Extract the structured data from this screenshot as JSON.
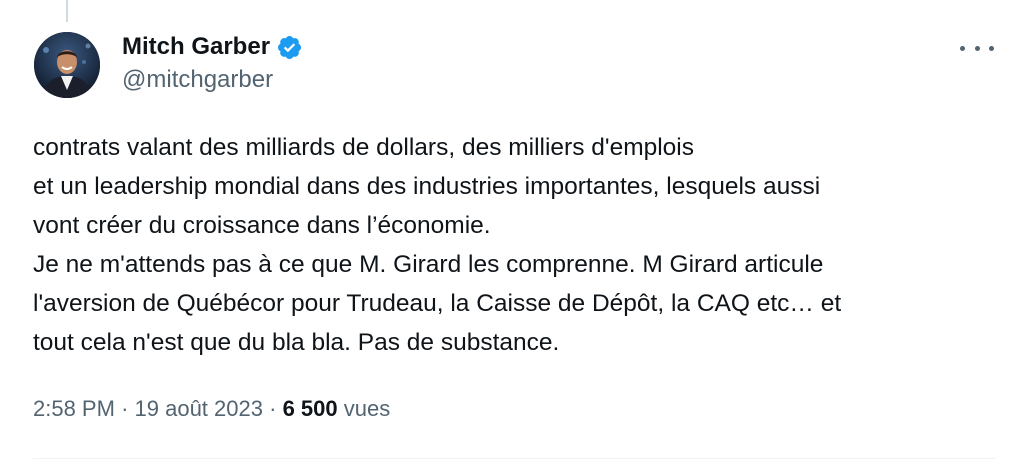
{
  "author": {
    "display_name": "Mitch Garber",
    "handle": "@mitchgarber",
    "verified_icon": "verified-badge-icon",
    "verified_color": "#1d9bf0"
  },
  "tweet": {
    "lines": [
      "contrats valant des milliards de dollars, des milliers d'emplois",
      "et un leadership mondial dans des industries importantes, lesquels aussi",
      "vont créer du croissance dans l’économie.",
      "Je ne m'attends pas à ce que M. Girard les comprenne. M Girard articule",
      "l'aversion de Québécor pour Trudeau, la Caisse de Dépôt, la CAQ etc… et",
      "tout cela n'est que du bla bla. Pas de substance."
    ]
  },
  "meta": {
    "time": "2:58 PM",
    "separator": "·",
    "date": "19 août 2023",
    "views_count": "6 500",
    "views_label": "vues"
  },
  "more_icon": "more-options-icon"
}
